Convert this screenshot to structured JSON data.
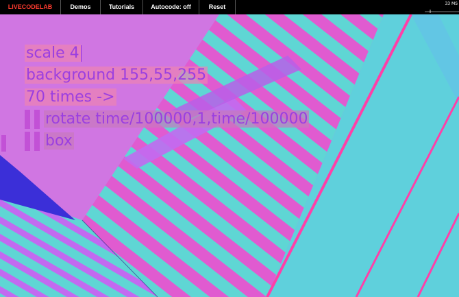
{
  "menu": {
    "logo": "LIVECODELAB",
    "items": [
      "Demos",
      "Tutorials",
      "Autocode: off",
      "Reset"
    ]
  },
  "stats": {
    "fps_label": "33 MS"
  },
  "editor": {
    "lines": [
      "scale 4",
      "background 155,55,255",
      "70 times ->",
      "rotate time/100000,1,time/100000",
      "box"
    ]
  },
  "colors": {
    "logo": "#ff3b2f",
    "magenta": "#e05bd0",
    "violet": "#c26af0",
    "teal": "#5fd6d4",
    "blue": "#3b2fd8",
    "pink": "#ff3fa8"
  }
}
